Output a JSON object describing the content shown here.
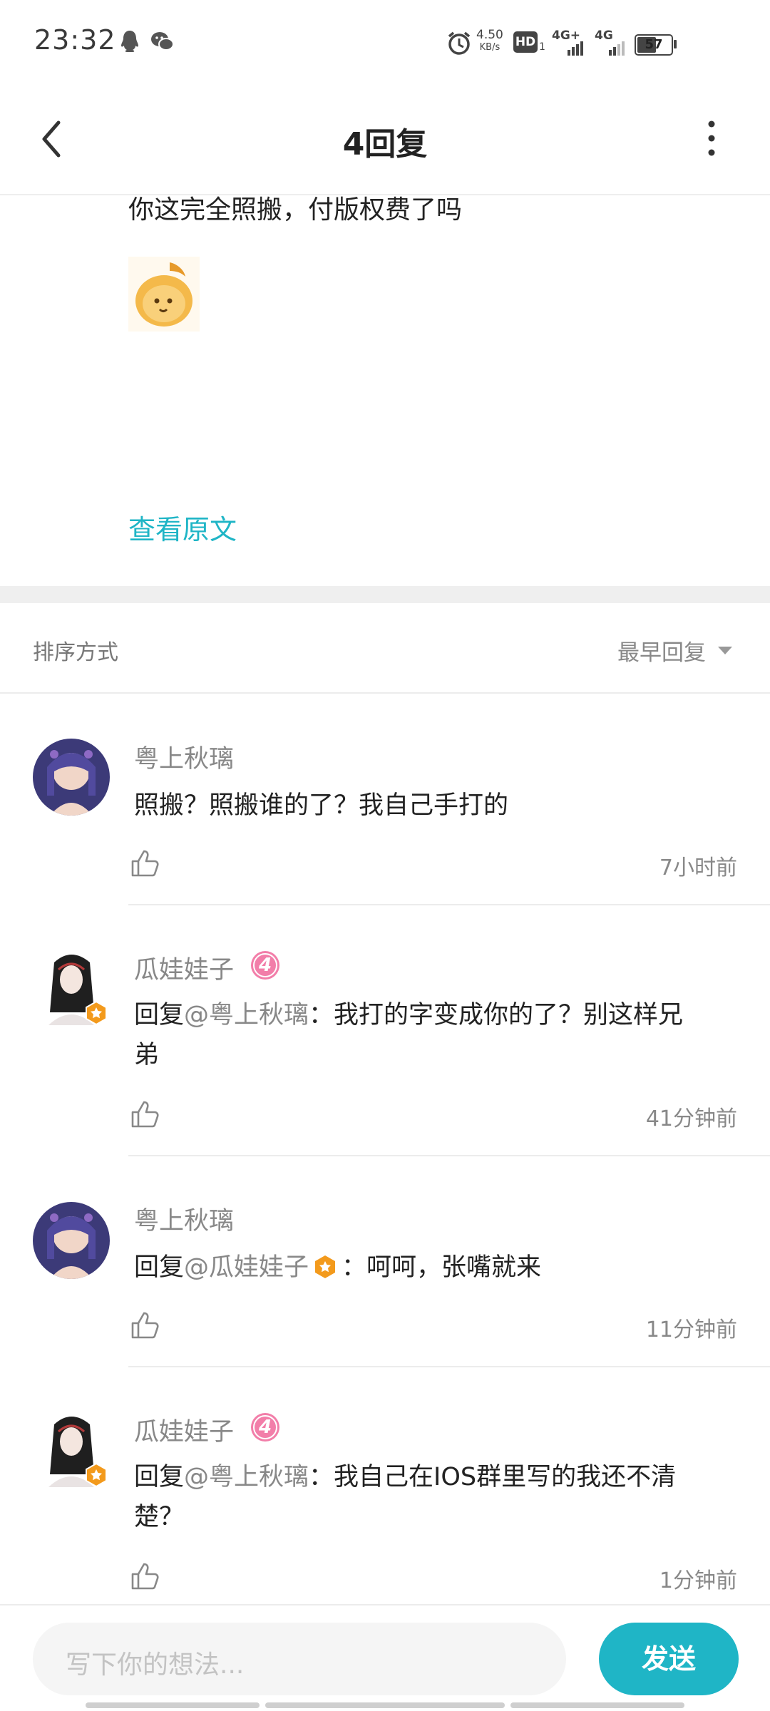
{
  "status_bar": {
    "time": "23:32",
    "net_speed_value": "4.50",
    "net_speed_unit": "KB/s",
    "hd_label": "HD",
    "hd_sub": "1",
    "sim1": "4G+",
    "sim2": "4G",
    "battery": "57",
    "icons": [
      "qq-icon",
      "wechat-icon",
      "alarm-icon",
      "hd-icon",
      "signal-icon",
      "battery-icon"
    ]
  },
  "header": {
    "title": "4回复",
    "icons": [
      "back-arrow-icon",
      "more-vertical-icon"
    ]
  },
  "original_post": {
    "text": "你这完全照搬，付版权费了吗",
    "view_original_label": "查看原文"
  },
  "sort": {
    "label": "排序方式",
    "value": "最早回复"
  },
  "comments": [
    {
      "author": "粤上秋璃",
      "text": "照搬？照搬谁的了？我自己手打的",
      "time": "7小时前"
    },
    {
      "author": "瓜娃娃子",
      "level": "4",
      "reply_prefix": "回复",
      "reply_to": "@粤上秋璃",
      "text_line1": "：我打的字变成你的了？别这样兄",
      "text_line2": "弟",
      "time": "41分钟前"
    },
    {
      "author": "粤上秋璃",
      "reply_prefix": "回复",
      "reply_to": "@瓜娃娃子",
      "text": "：呵呵，张嘴就来",
      "time": "11分钟前"
    },
    {
      "author": "瓜娃娃子",
      "level": "4",
      "reply_prefix": "回复",
      "reply_to": "@粤上秋璃",
      "text_line1": "：我自己在IOS群里写的我还不清",
      "text_line2": "楚？",
      "time": "1分钟前"
    }
  ],
  "composer": {
    "placeholder": "写下你的想法...",
    "send_label": "发送"
  },
  "colors": {
    "accent": "#1fb5c6",
    "level_badge": "#f27ea9",
    "vip_badge": "#f39a1c"
  }
}
